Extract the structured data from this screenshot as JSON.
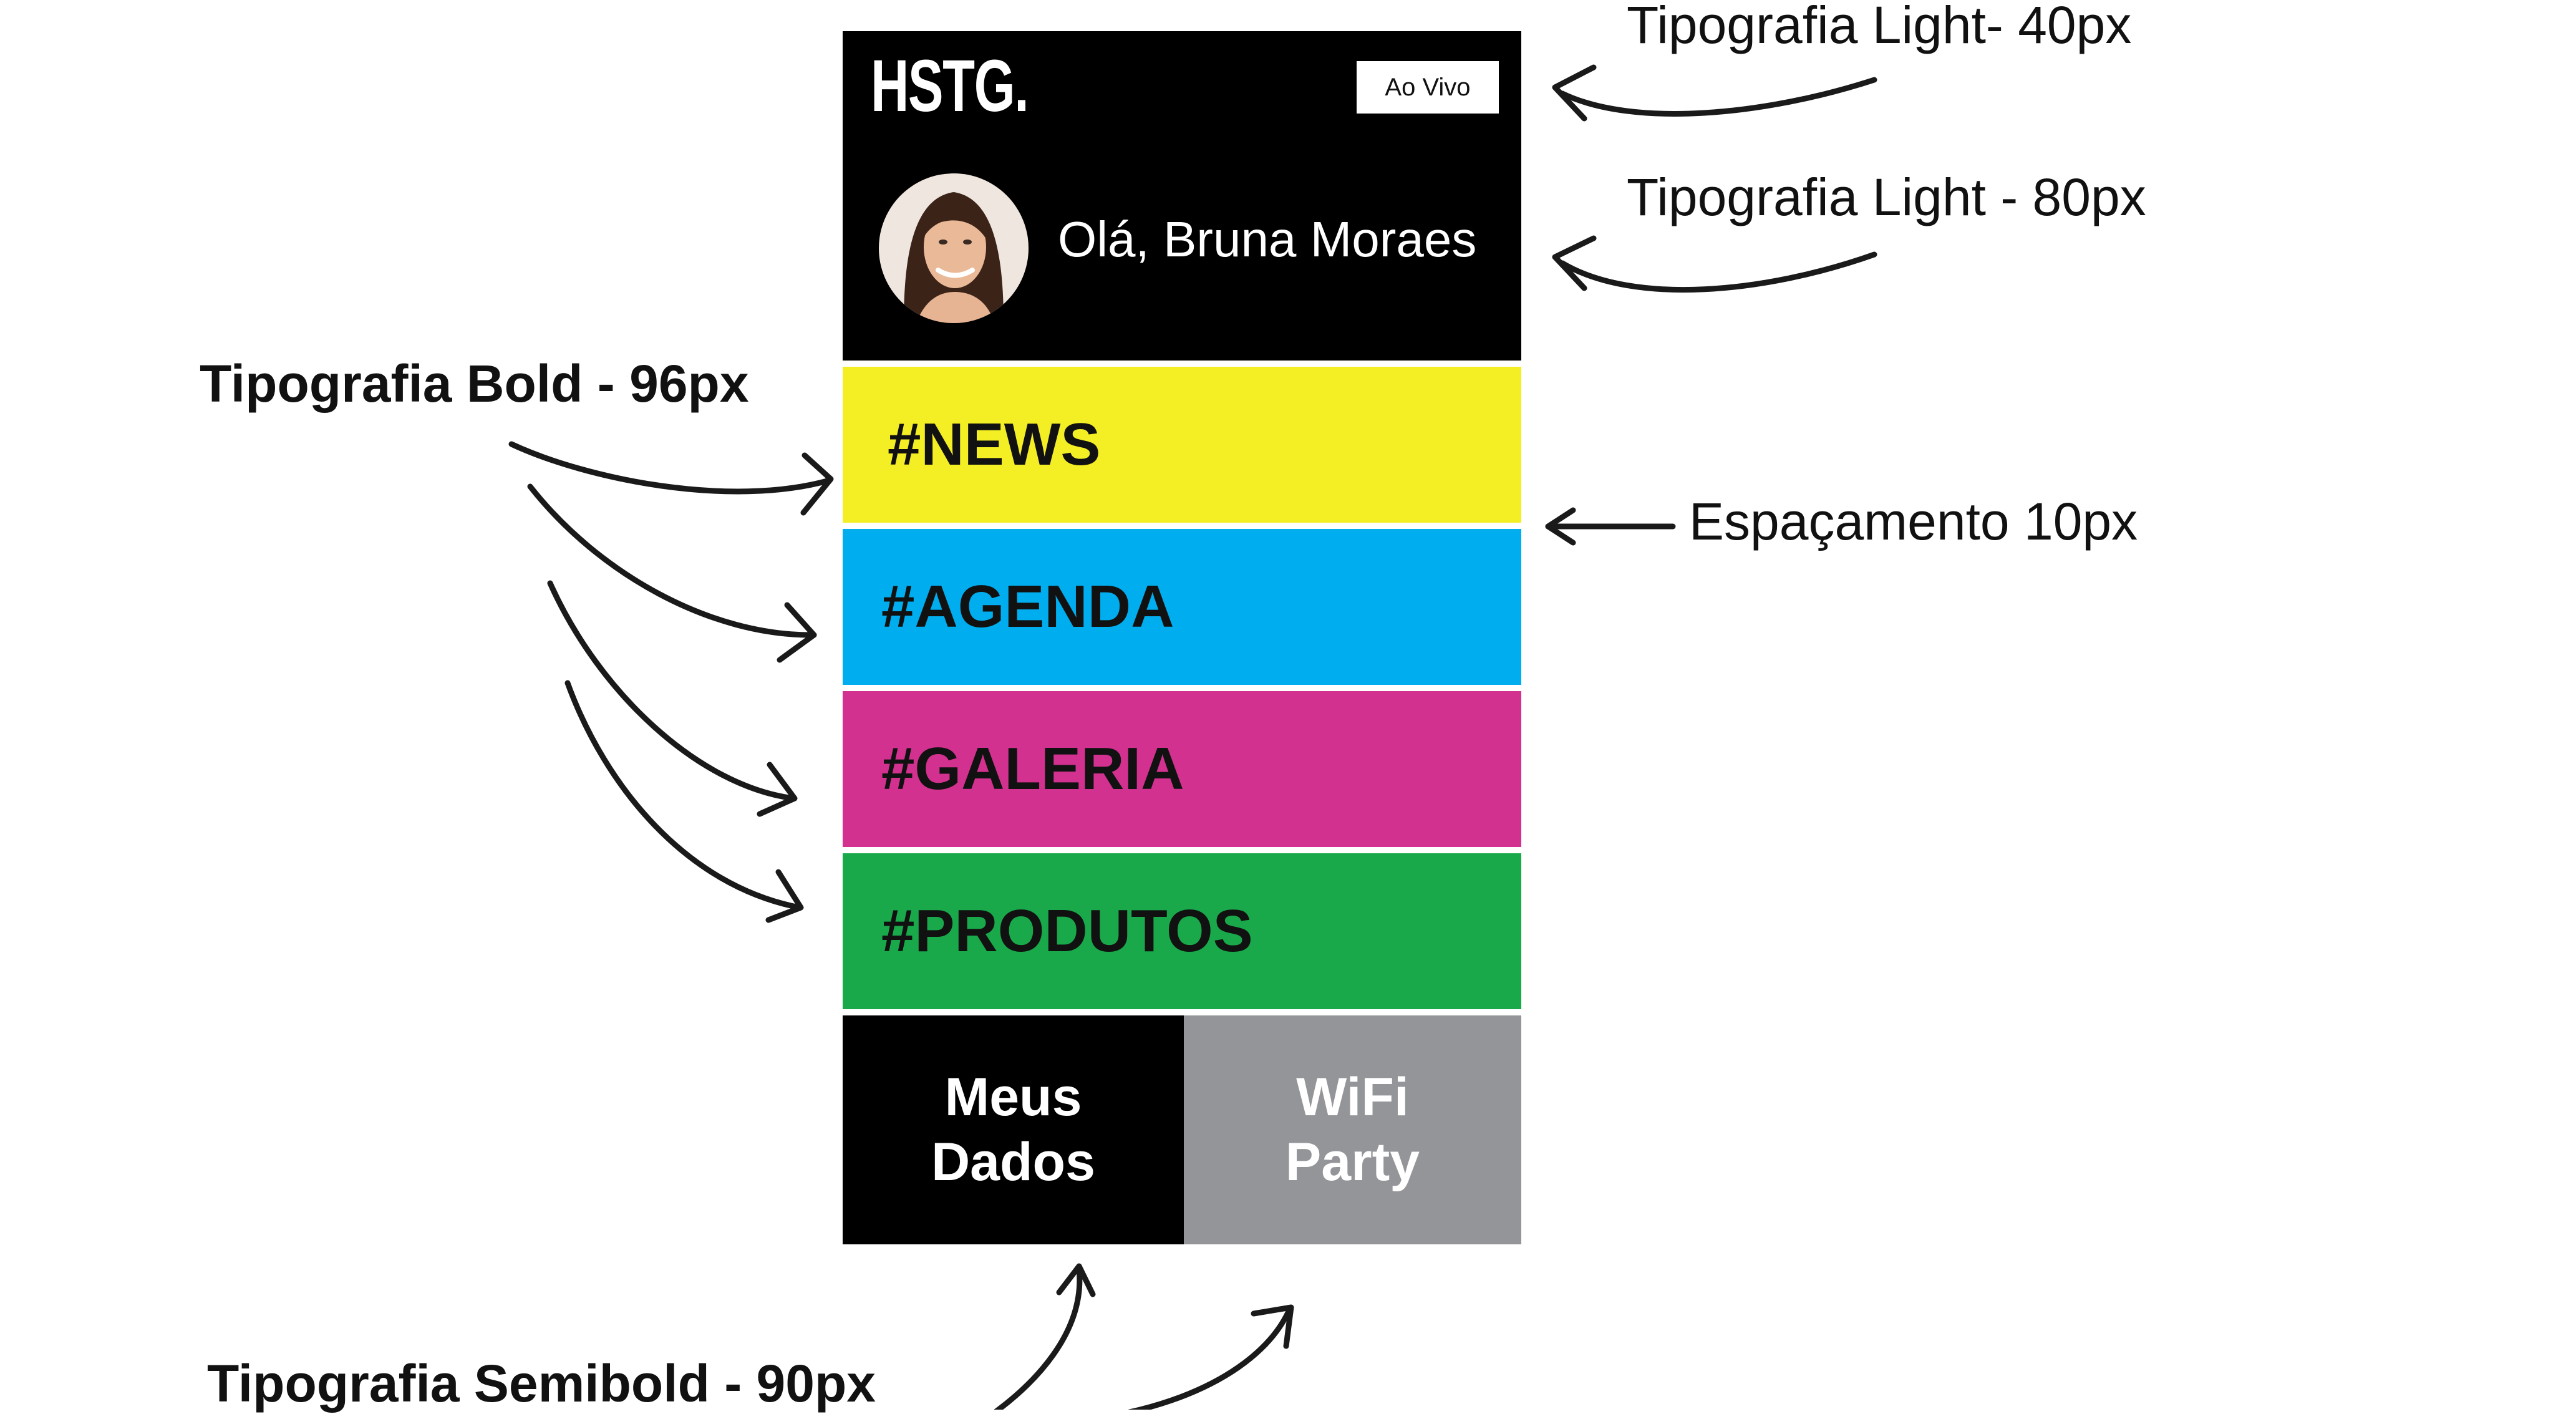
{
  "app": {
    "logo": "HSTG.",
    "live_button": "Ao Vivo",
    "greeting": "Olá, Bruna Moraes"
  },
  "menu": {
    "items": [
      {
        "label": "#NEWS",
        "color": "#f4ee24"
      },
      {
        "label": "#AGENDA",
        "color": "#00aeef"
      },
      {
        "label": "#GALERIA",
        "color": "#d2318f"
      },
      {
        "label": "#PRODUTOS",
        "color": "#19a94a"
      }
    ]
  },
  "footer": {
    "left": {
      "label": "Meus\nDados",
      "color": "#000000"
    },
    "right": {
      "label": "WiFi\nParty",
      "color": "#939598"
    }
  },
  "annotations": {
    "light_40": "Tipografia Light- 40px",
    "light_80": "Tipografia Light - 80px",
    "bold_96": "Tipografia Bold - 96px",
    "spacing": "Espaçamento 10px",
    "semibold_90": "Tipografia Semibold - 90px"
  }
}
